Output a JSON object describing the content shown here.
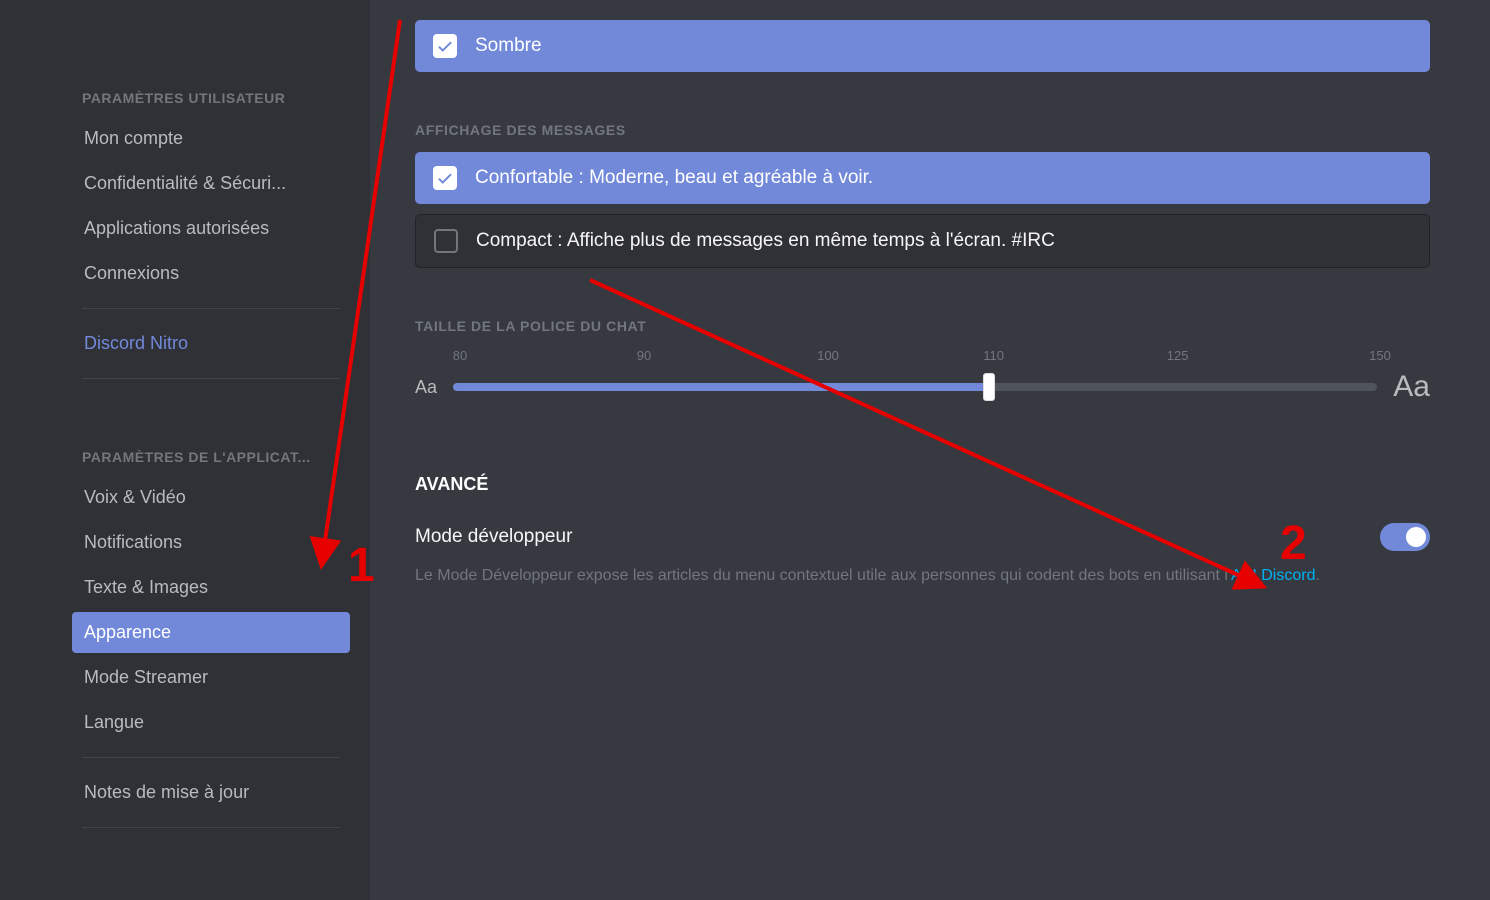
{
  "sidebar": {
    "header_user": "PARAMÈTRES UTILISATEUR",
    "items_user": [
      {
        "label": "Mon compte"
      },
      {
        "label": "Confidentialité & Sécuri..."
      },
      {
        "label": "Applications autorisées"
      },
      {
        "label": "Connexions"
      }
    ],
    "nitro": "Discord Nitro",
    "header_app": "PARAMÈTRES DE L'APPLICAT...",
    "items_app": [
      {
        "label": "Voix & Vidéo"
      },
      {
        "label": "Notifications"
      },
      {
        "label": "Texte & Images"
      },
      {
        "label": "Apparence",
        "active": true
      },
      {
        "label": "Mode Streamer"
      },
      {
        "label": "Langue"
      }
    ],
    "changelog": "Notes de mise à jour"
  },
  "theme": {
    "option_dark": "Sombre"
  },
  "messages": {
    "header": "AFFICHAGE DES MESSAGES",
    "option_cozy": "Confortable : Moderne, beau et agréable à voir.",
    "option_compact": "Compact : Affiche plus de messages en même temps à l'écran. #IRC"
  },
  "font": {
    "header": "TAILLE DE LA POLICE DU CHAT",
    "aa_small": "Aa",
    "aa_big": "Aa",
    "ticks": [
      "80",
      "90",
      "100",
      "110",
      "125",
      "150"
    ],
    "value_percent": 58
  },
  "advanced": {
    "header": "AVANCÉ",
    "dev_mode_label": "Mode développeur",
    "dev_mode_desc_1": "Le Mode Développeur expose les articles du menu contextuel utile aux personnes qui codent des bots en utilisant l'",
    "dev_mode_link": "API Discord",
    "dev_mode_desc_2": "."
  },
  "annotations": {
    "one": "1",
    "two": "2"
  }
}
